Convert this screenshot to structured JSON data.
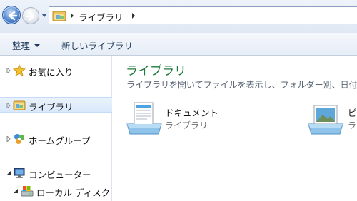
{
  "address_bar": {
    "path_segment": "ライブラリ"
  },
  "toolbar": {
    "organize_label": "整理",
    "new_library_label": "新しいライブラリ"
  },
  "nav": {
    "favorites": "お気に入り",
    "libraries": "ライブラリ",
    "homegroup": "ホームグループ",
    "computer": "コンピューター",
    "local_disk": "ローカル ディスク ("
  },
  "content": {
    "title": "ライブラリ",
    "subtitle": "ライブラリを開いてファイルを表示し、フォルダー別、日付",
    "items": [
      {
        "name": "ドキュメント",
        "type": "ライブラリ"
      },
      {
        "name": "ピク",
        "type": "ラ"
      }
    ]
  },
  "colors": {
    "title_green": "#1e7a3c",
    "selection_blue": "#d9e9fb",
    "toolbar_text": "#1e395b"
  }
}
